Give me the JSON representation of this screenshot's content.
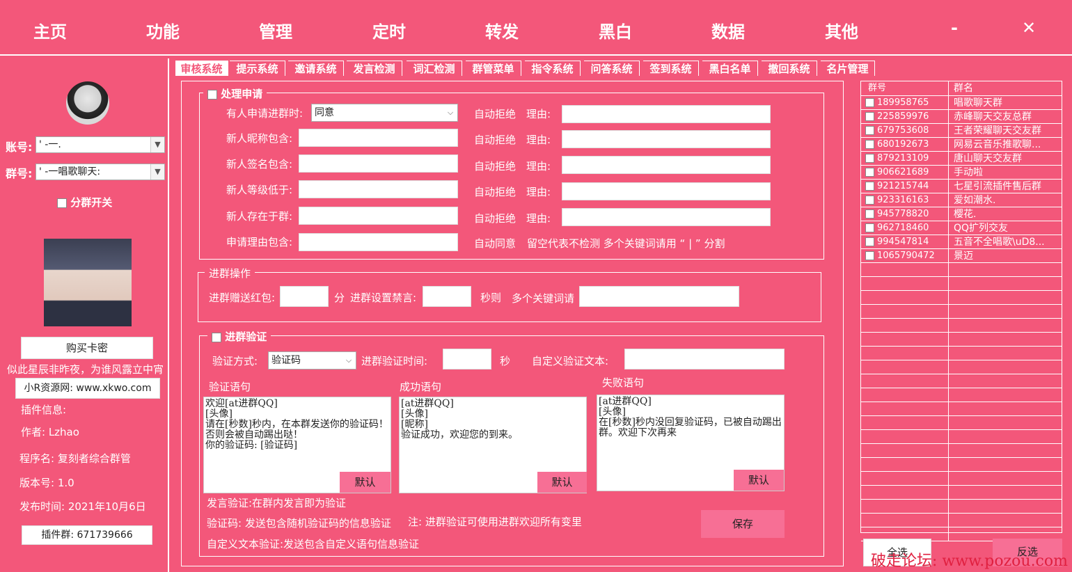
{
  "nav": {
    "items": [
      "主页",
      "功能",
      "管理",
      "定时",
      "转发",
      "黑白",
      "数据",
      "其他"
    ],
    "minimize": "-",
    "close": "✕"
  },
  "left": {
    "account_label": "账号:",
    "account_value": "'  -一.",
    "group_label": "群号:",
    "group_value": "'      -一唱歌聊天:",
    "split_toggle": "分群开关",
    "buy_button": "购买卡密",
    "slogan": "似此星辰非昨夜，为谁风露立中宵",
    "site_button": "小R资源网: www.xkwo.com",
    "info_title": "插件信息:",
    "author": "作者: Lzhao",
    "program": "程序名: 复刻者综合群管",
    "version": "版本号: 1.0",
    "release": "发布时间: 2021年10月6日",
    "plugin_group_button": "插件群: 671739666"
  },
  "tabs": [
    "审核系统",
    "提示系统",
    "邀请系统",
    "发言检测",
    "词汇检测",
    "群管菜单",
    "指令系统",
    "问答系统",
    "签到系统",
    "黑白名单",
    "撤回系统",
    "名片管理"
  ],
  "apply": {
    "title": "处理申请",
    "row1_label": "有人申请进群时:",
    "row1_select": "同意",
    "row2_label": "新人昵称包含:",
    "row3_label": "新人签名包含:",
    "row4_label": "新人等级低于:",
    "row5_label": "新人存在于群:",
    "row6_label": "申请理由包含:",
    "auto_reject": "自动拒绝",
    "reason": "理由:",
    "auto_agree": "自动同意",
    "hint": "留空代表不检测    多个关键词请用 “ | ” 分割"
  },
  "join": {
    "title": "进群操作",
    "redpacket": "进群赠送红包:",
    "unit_fen": "分",
    "mute": "进群设置禁言:",
    "unit_sec": "秒则",
    "keywords": "多个关键词请"
  },
  "verify": {
    "title": "进群验证",
    "method_label": "验证方式:",
    "method_value": "验证码",
    "time_label": "进群验证时间:",
    "time_unit": "秒",
    "custom_label": "自定义验证文本:",
    "col1_title": "验证语句",
    "col2_title": "成功语句",
    "col3_title": "失败语句",
    "text1": "欢迎[at进群QQ]\n[头像]\n请在[秒数]秒内，在本群发送你的验证码！否则会被自动踢出哒！\n你的验证码: [验证码]",
    "text2": "[at进群QQ]\n[头像]\n[昵称]\n验证成功，欢迎您的到来。",
    "text3": "[at进群QQ]\n[头像]\n在[秒数]秒内没回复验证码，已被自动踢出群。欢迎下次再来",
    "default_btn": "默认",
    "note1": "发言验证:在群内发言即为验证",
    "note2": "验证码: 发送包含随机验证码的信息验证",
    "note3": "注: 进群验证可使用进群欢迎所有变里",
    "note4": "自定义文本验证:发送包含自定义语句信息验证",
    "save_btn": "保存"
  },
  "grouplist": {
    "col1": "群号",
    "col2": "群名",
    "rows": [
      [
        "189958765",
        "唱歌聊天群"
      ],
      [
        "225859976",
        "赤峰聊天交友总群"
      ],
      [
        "679753608",
        "王者荣耀聊天交友群"
      ],
      [
        "680192673",
        "网易云音乐推歌聊..."
      ],
      [
        "879213109",
        "唐山聊天交友群"
      ],
      [
        "906621689",
        "手动啦"
      ],
      [
        "921215744",
        "七星引流插件售后群"
      ],
      [
        "923316163",
        "爱如潮水."
      ],
      [
        "945778820",
        "樱花."
      ],
      [
        "962718460",
        "QQ扩列交友"
      ],
      [
        "994547814",
        "五音不全唱歌\\uD8..."
      ],
      [
        "1065790472",
        "景迈"
      ]
    ],
    "select_all": "全选",
    "invert": "反选"
  },
  "watermark": "破走论坛: www.pozou.com"
}
